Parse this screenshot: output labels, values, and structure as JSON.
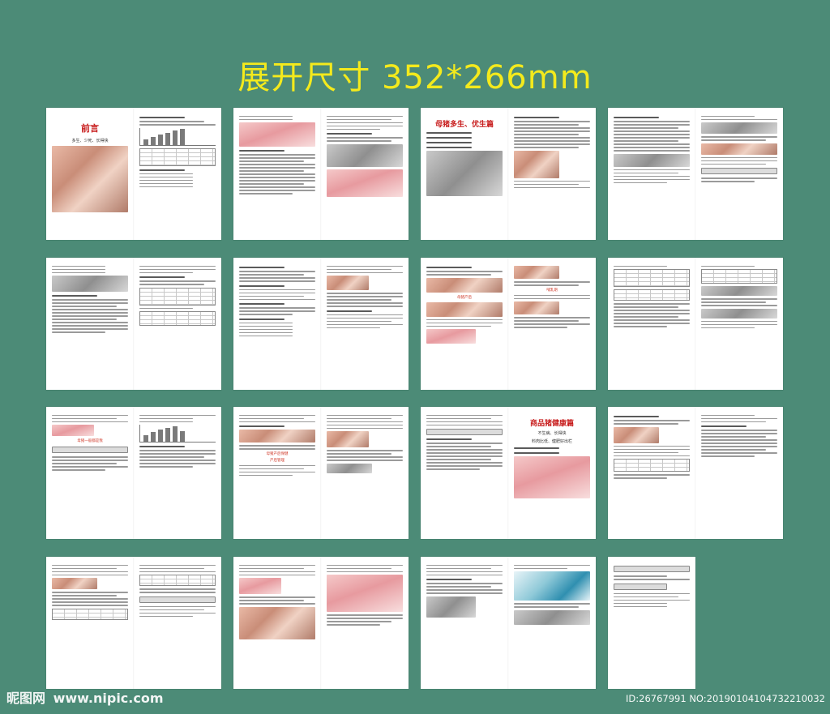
{
  "headline": "展开尺寸  352*266mm",
  "spreads": [
    {
      "id": 1,
      "title": "前言",
      "subtitle": "多生、少死、长得快"
    },
    {
      "id": 2
    },
    {
      "id": 3,
      "title": "母猪多生、优生篇"
    },
    {
      "id": 4
    },
    {
      "id": 5
    },
    {
      "id": 6
    },
    {
      "id": 7,
      "red_label_a": "母猪产后",
      "red_label_b": "哺乳期"
    },
    {
      "id": 8
    },
    {
      "id": 9,
      "red_label": "母猪一般都是我"
    },
    {
      "id": 10,
      "red_label_a": "母猪产后保健",
      "red_label_b": "产后管理"
    },
    {
      "id": 11
    },
    {
      "id": 12,
      "title": "商品猪健康篇",
      "subtitle": "不生病、长得快",
      "subtitle2": "料肉比低、健肥好出栏"
    },
    {
      "id": 13
    },
    {
      "id": 14
    },
    {
      "id": 15
    },
    {
      "id": 16
    }
  ],
  "watermark": {
    "logo": "昵图网",
    "url": "www.nipic.com",
    "id_text": "ID:26767991 NO:20190104104732210032"
  }
}
